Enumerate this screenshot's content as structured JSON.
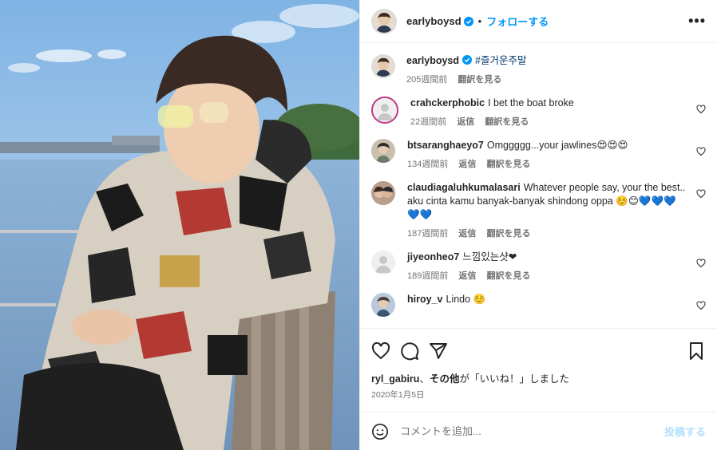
{
  "header": {
    "username": "earlyboysd",
    "separator": "•",
    "follow_label": "フォローする",
    "more_label": "•••"
  },
  "caption": {
    "username": "earlyboysd",
    "text": "#즐거운주말",
    "time": "205週間前",
    "translate": "翻訳を見る"
  },
  "comments": [
    {
      "username": "crahckerphobic",
      "text": "I bet the boat broke",
      "time": "22週間前",
      "reply": "返信",
      "translate": "翻訳を見る"
    },
    {
      "username": "btsaranghaeyo7",
      "text": "Omggggg...your jawlines😍😍😍",
      "time": "134週間前",
      "reply": "返信",
      "translate": "翻訳を見る"
    },
    {
      "username": "claudiagaluhkumalasari",
      "text": "Whatever people say, your the best.. aku cinta kamu banyak-banyak shindong oppa ☺️😊💙💙💙💙💙",
      "time": "187週間前",
      "reply": "返信",
      "translate": "翻訳を見る"
    },
    {
      "username": "jiyeonheo7",
      "text": "느낌있는샷❤",
      "time": "189週間前",
      "reply": "返信",
      "translate": "翻訳を見る"
    },
    {
      "username": "hiroy_v",
      "text": "Lindo ☺️",
      "time": "",
      "reply": "",
      "translate": ""
    }
  ],
  "likes": {
    "user": "ryl_gabiru",
    "sep": "、",
    "others": "その他",
    "suffix": "が「いいね！」しました"
  },
  "date": "2020年1月5日",
  "add_comment": {
    "placeholder": "コメントを追加...",
    "post_label": "投稿する"
  },
  "colors": {
    "accent": "#0095f6",
    "post_disabled": "#b2dffc",
    "verified": "#0095f6"
  }
}
